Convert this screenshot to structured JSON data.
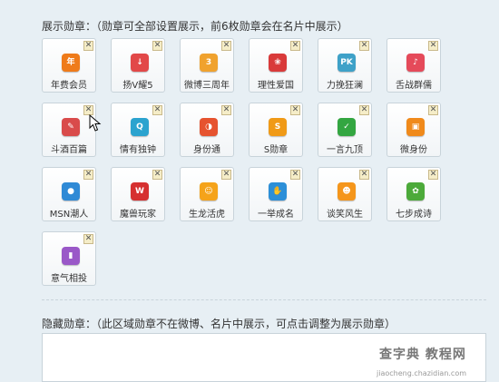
{
  "display_title": "展示勋章：（勋章可全部设置展示，前6枚勋章会在名片中展示）",
  "hidden_title": "隐藏勋章：（此区域勋章不在微博、名片中展示，可点击调整为展示勋章）",
  "close_glyph": "✕",
  "badges": [
    {
      "label": "年费会员",
      "glyph": "年",
      "color": "#ef7b1a"
    },
    {
      "label": "扬V耀5",
      "glyph": "↓",
      "color": "#e24848"
    },
    {
      "label": "微博三周年",
      "glyph": "3",
      "color": "#f0a22e"
    },
    {
      "label": "理性爱国",
      "glyph": "❀",
      "color": "#d93a3a"
    },
    {
      "label": "力挽狂澜",
      "glyph": "PK",
      "color": "#3ea1c8"
    },
    {
      "label": "舌战群儒",
      "glyph": "♪",
      "color": "#e54a5a"
    },
    {
      "label": "斗酒百篇",
      "glyph": "✎",
      "color": "#d94b4b"
    },
    {
      "label": "情有独钟",
      "glyph": "Q",
      "color": "#2ba3cf"
    },
    {
      "label": "身份通",
      "glyph": "◑",
      "color": "#e6532f"
    },
    {
      "label": "S勋章",
      "glyph": "S",
      "color": "#f09a17"
    },
    {
      "label": "一言九顶",
      "glyph": "✓",
      "color": "#33a641"
    },
    {
      "label": "微身份",
      "glyph": "▣",
      "color": "#f08a1b"
    },
    {
      "label": "MSN潮人",
      "glyph": "●",
      "color": "#2f8ad6"
    },
    {
      "label": "魔兽玩家",
      "glyph": "W",
      "color": "#d63030"
    },
    {
      "label": "生龙活虎",
      "glyph": "☺",
      "color": "#f5a31a"
    },
    {
      "label": "一举成名",
      "glyph": "✋",
      "color": "#2c8fd8"
    },
    {
      "label": "谈笑风生",
      "glyph": "☻",
      "color": "#f5961b"
    },
    {
      "label": "七步成诗",
      "glyph": "✿",
      "color": "#4caa3a"
    },
    {
      "label": "意气相投",
      "glyph": "▮",
      "color": "#9a58c8"
    }
  ],
  "watermark": "查字典 教程网",
  "watermark_url": "jiaocheng.chazidian.com"
}
